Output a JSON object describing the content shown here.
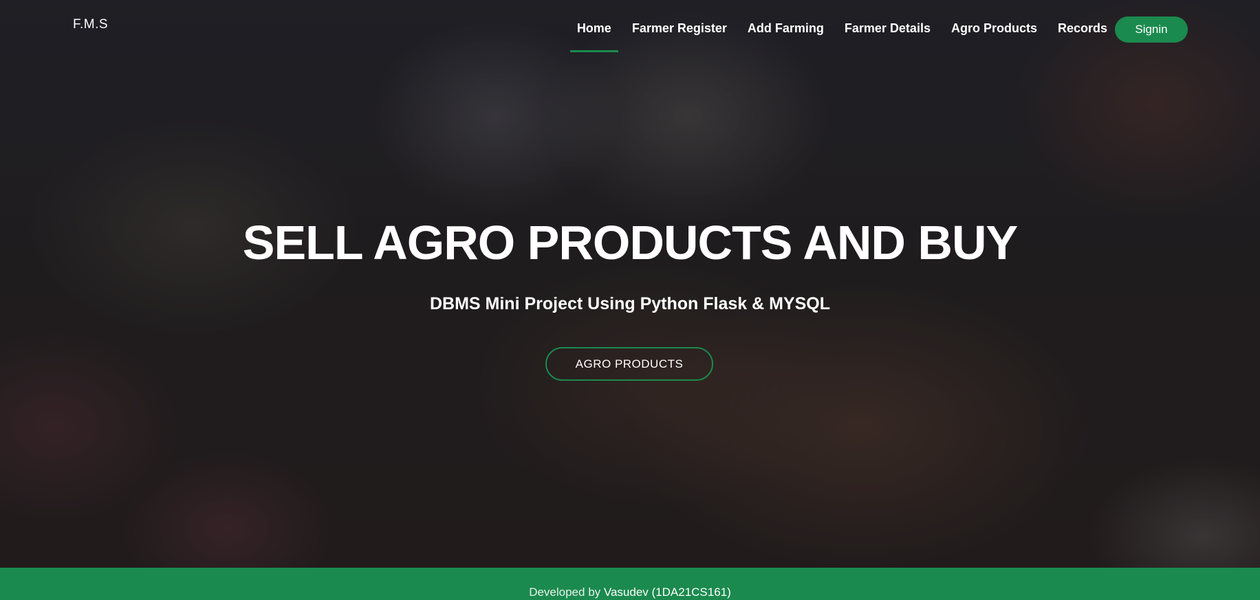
{
  "brand": "F.M.S",
  "nav": {
    "items": [
      {
        "label": "Home"
      },
      {
        "label": "Farmer Register"
      },
      {
        "label": "Add Farming"
      },
      {
        "label": "Farmer Details"
      },
      {
        "label": "Agro Products"
      },
      {
        "label": "Records"
      }
    ],
    "active": "Home",
    "signin_label": "Signin"
  },
  "hero": {
    "title": "SELL AGRO PRODUCTS AND BUY",
    "subtitle": "DBMS Mini Project Using Python Flask & MYSQL",
    "cta_label": "AGRO PRODUCTS"
  },
  "footer": {
    "prefix": "Developed by",
    "developer": "Vasudev (1DA21CS161)"
  },
  "colors": {
    "accent": "#1b8a4e",
    "text": "#ffffff"
  }
}
